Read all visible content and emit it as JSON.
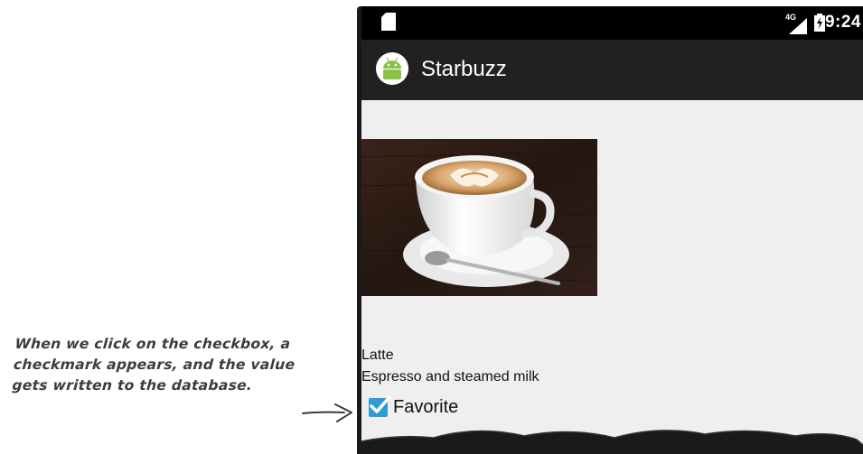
{
  "status_bar": {
    "network": "4G",
    "time": "9:24"
  },
  "app_bar": {
    "title": "Starbuzz",
    "icon": "android-robot-icon"
  },
  "drink": {
    "image": "latte-photo",
    "name": "Latte",
    "description": "Espresso and steamed milk"
  },
  "favorite": {
    "label": "Favorite",
    "checked": true
  },
  "annotation": {
    "lines": [
      "When we click on the checkbox, a",
      "checkmark appears, and the value",
      "gets written to the database."
    ]
  },
  "colors": {
    "status_bar_bg": "#000000",
    "app_bar_bg": "#212121",
    "content_bg": "#efefef",
    "checkbox_accent": "#2f9bd8",
    "android_green": "#8bc34a"
  }
}
